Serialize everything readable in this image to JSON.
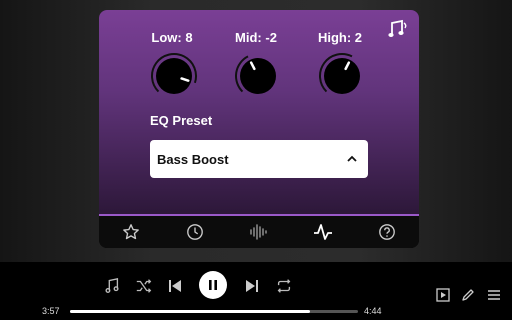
{
  "equalizer": {
    "knobs": [
      {
        "id": "low",
        "label": "Low: 8",
        "value": 8
      },
      {
        "id": "mid",
        "label": "Mid: -2",
        "value": -2
      },
      {
        "id": "high",
        "label": "High: 2",
        "value": 2
      }
    ],
    "knob_range": [
      -10,
      10
    ],
    "preset_label": "EQ Preset",
    "preset_value": "Bass Boost",
    "accent_color": "#9b59c9",
    "header_icon": "music-note-icon"
  },
  "tabs": [
    {
      "icon": "star-icon"
    },
    {
      "icon": "clock-icon"
    },
    {
      "icon": "waveform-icon"
    },
    {
      "icon": "pulse-icon",
      "active": true
    },
    {
      "icon": "help-icon"
    }
  ],
  "player": {
    "elapsed": "3:57",
    "total": "4:44",
    "progress": 0.835,
    "state": "playing",
    "controls": [
      "music-note-icon",
      "shuffle-icon",
      "previous-icon",
      "pause-icon",
      "next-icon",
      "repeat-icon"
    ],
    "side_actions": [
      "queue-play-icon",
      "edit-icon",
      "menu-icon"
    ]
  }
}
